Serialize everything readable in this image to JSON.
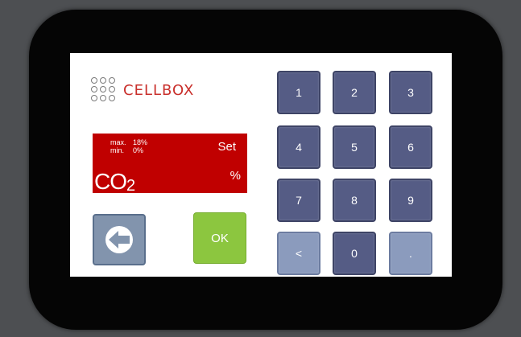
{
  "brand": {
    "name": "CELLBOX"
  },
  "display": {
    "max_label": "max.",
    "max_value": "18%",
    "min_label": "min.",
    "min_value": "0%",
    "mode_label": "Set",
    "unit": "%",
    "gas_main": "CO",
    "gas_sub": "2"
  },
  "buttons": {
    "ok_label": "OK",
    "back_icon": "arrow-left-icon"
  },
  "keypad": {
    "k1": "1",
    "k2": "2",
    "k3": "3",
    "k4": "4",
    "k5": "5",
    "k6": "6",
    "k7": "7",
    "k8": "8",
    "k9": "9",
    "backspace": "<",
    "k0": "0",
    "dot": "."
  },
  "colors": {
    "display_bg": "#c00000",
    "ok_bg": "#8cc63f",
    "key_bg": "#555c85",
    "key_light_bg": "#8b9bbd",
    "logo_red": "#c9302c"
  }
}
